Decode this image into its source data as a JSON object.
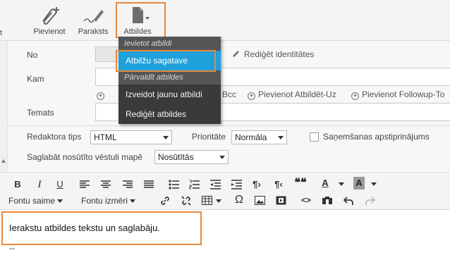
{
  "toolbar": {
    "left_fragment": "t",
    "attach": "Pievienot",
    "sign": "Paraksts",
    "responses": "Atbildes"
  },
  "menu": {
    "section_insert": "Ievietot atbildi",
    "item_template": "Atbilžu sagatave",
    "section_manage": "Pārvaldīt atbildes",
    "item_create": "Izveidot jaunu atbildi",
    "item_edit": "Rediģēt atbildes"
  },
  "form": {
    "from_label": "No",
    "edit_identities": "Rediģēt identitātes",
    "to_label": "Kam",
    "add_bcc": "Bcc",
    "add_reply_to": "Pievienot Atbildēt-Uz",
    "add_followup": "Pievienot Followup-To",
    "subject_label": "Temats",
    "editor_type_label": "Redaktora tips",
    "editor_type_value": "HTML",
    "priority_label": "Prioritāte",
    "priority_value": "Normāla",
    "receipt_label": "Saņemšanas apstiprinājums",
    "save_sent_label": "Saglabāt nosūtīto vēstuli mapē",
    "save_sent_value": "Nosūtītās"
  },
  "editor_toolbar": {
    "bold": "B",
    "italic": "I",
    "underline": "U",
    "font_family": "Fontu saime",
    "font_size": "Fontu izmēri",
    "omega": "Ω",
    "code": "<>",
    "quote": "❝❝",
    "text_color": "A",
    "bg_color": "A"
  },
  "editor": {
    "body_text": "Ierakstu atbildes tekstu un saglabāju.",
    "signature": "--"
  },
  "colors": {
    "highlight": "#e8893b",
    "menu_bg": "#3a3a3a",
    "menu_active": "#1ea0db"
  }
}
